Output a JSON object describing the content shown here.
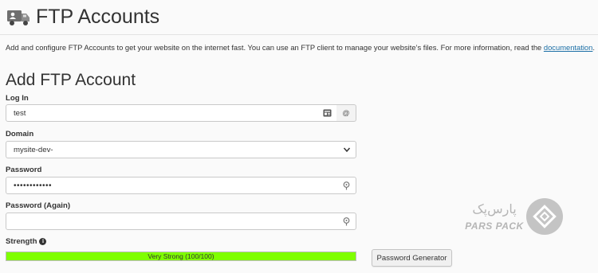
{
  "header": {
    "title": "FTP Accounts",
    "icon": "ftp-truck-icon"
  },
  "description": {
    "text": "Add and configure FTP Accounts to get your website on the internet fast. You can use an FTP client to manage your website’s files. For more information, read the ",
    "link_text": "documentation",
    "suffix": "."
  },
  "form": {
    "title": "Add FTP Account",
    "login": {
      "label": "Log In",
      "value": "test",
      "addon": "@"
    },
    "domain": {
      "label": "Domain",
      "value": "mysite-dev-"
    },
    "password": {
      "label": "Password",
      "value": "••••••••••••"
    },
    "password_again": {
      "label": "Password (Again)",
      "value": ""
    },
    "strength": {
      "label": "Strength",
      "text": "Very Strong (100/100)",
      "score": 100
    },
    "generator_button": "Password Generator"
  },
  "watermark": {
    "persian": "پارس‌پک",
    "latin": "PARS PACK"
  },
  "colors": {
    "accent_link": "#1c6fa6",
    "strength_fill": "#7fff00",
    "page_bg": "#fafafa"
  }
}
